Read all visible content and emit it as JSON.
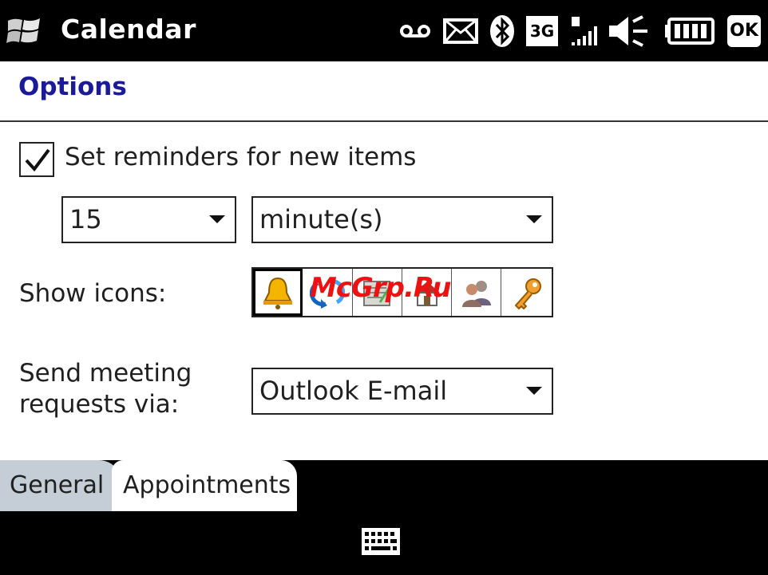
{
  "titlebar": {
    "app_title": "Calendar",
    "status_icons": [
      "voicemail-icon",
      "message-icon",
      "bluetooth-icon",
      "3g-icon",
      "signal-icon",
      "volume-muted-icon",
      "battery-icon",
      "ok-button"
    ],
    "threeg_label": "3G",
    "ok_label": "OK"
  },
  "header": {
    "title": "Options"
  },
  "form": {
    "reminder_label": "Set reminders for new items",
    "reminder_checked": true,
    "reminder_amount": "15",
    "reminder_unit": "minute(s)",
    "show_icons_label": "Show icons:",
    "icons": [
      "bell-icon",
      "recurrence-icon",
      "note-icon",
      "location-icon",
      "attendees-icon",
      "key-icon"
    ],
    "selected_icon": "bell-icon",
    "send_label_line1": "Send meeting",
    "send_label_line2": "requests via:",
    "send_via_value": "Outlook E-mail"
  },
  "watermark": "McGrp.Ru",
  "tabs": [
    {
      "label": "General"
    },
    {
      "label": "Appointments"
    }
  ],
  "softbar": {
    "icon": "keyboard-icon"
  }
}
